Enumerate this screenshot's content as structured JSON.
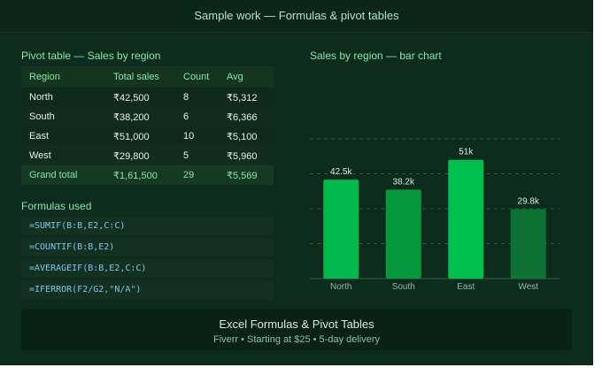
{
  "header": {
    "title": "Sample work — Formulas & pivot tables"
  },
  "pivot": {
    "title": "Pivot table — Sales by region",
    "columns": [
      "Region",
      "Total sales",
      "Count",
      "Avg"
    ],
    "rows": [
      [
        "North",
        "₹42,500",
        "8",
        "₹5,312"
      ],
      [
        "South",
        "₹38,200",
        "6",
        "₹6,366"
      ],
      [
        "East",
        "₹51,000",
        "10",
        "₹5,100"
      ],
      [
        "West",
        "₹29,800",
        "5",
        "₹5,960"
      ]
    ],
    "total": [
      "Grand total",
      "₹1,61,500",
      "29",
      "₹5,569"
    ]
  },
  "formulas": {
    "title": "Formulas used",
    "items": [
      "=SUMIF(B:B,E2,C:C)",
      "=COUNTIF(B:B,E2)",
      "=AVERAGEIF(B:B,E2,C:C)",
      "=IFERROR(F2/G2,\"N/A\")"
    ]
  },
  "chart_title": "Sales by region — bar chart",
  "chart_data": {
    "type": "bar",
    "title": "Sales by region — bar chart",
    "categories": [
      "North",
      "South",
      "East",
      "West"
    ],
    "values": [
      42.5,
      38.2,
      51,
      29.8
    ],
    "data_labels": [
      "42.5k",
      "38.2k",
      "51k",
      "29.8k"
    ],
    "ylim": [
      0,
      60
    ],
    "grid": true,
    "colors": [
      "#00b84c",
      "#07973d",
      "#00c04d",
      "#0e7235"
    ]
  },
  "banner": {
    "title": "Excel Formulas & Pivot Tables",
    "subtitle": "Fiverr • Starting at $25 • 5-day delivery"
  }
}
